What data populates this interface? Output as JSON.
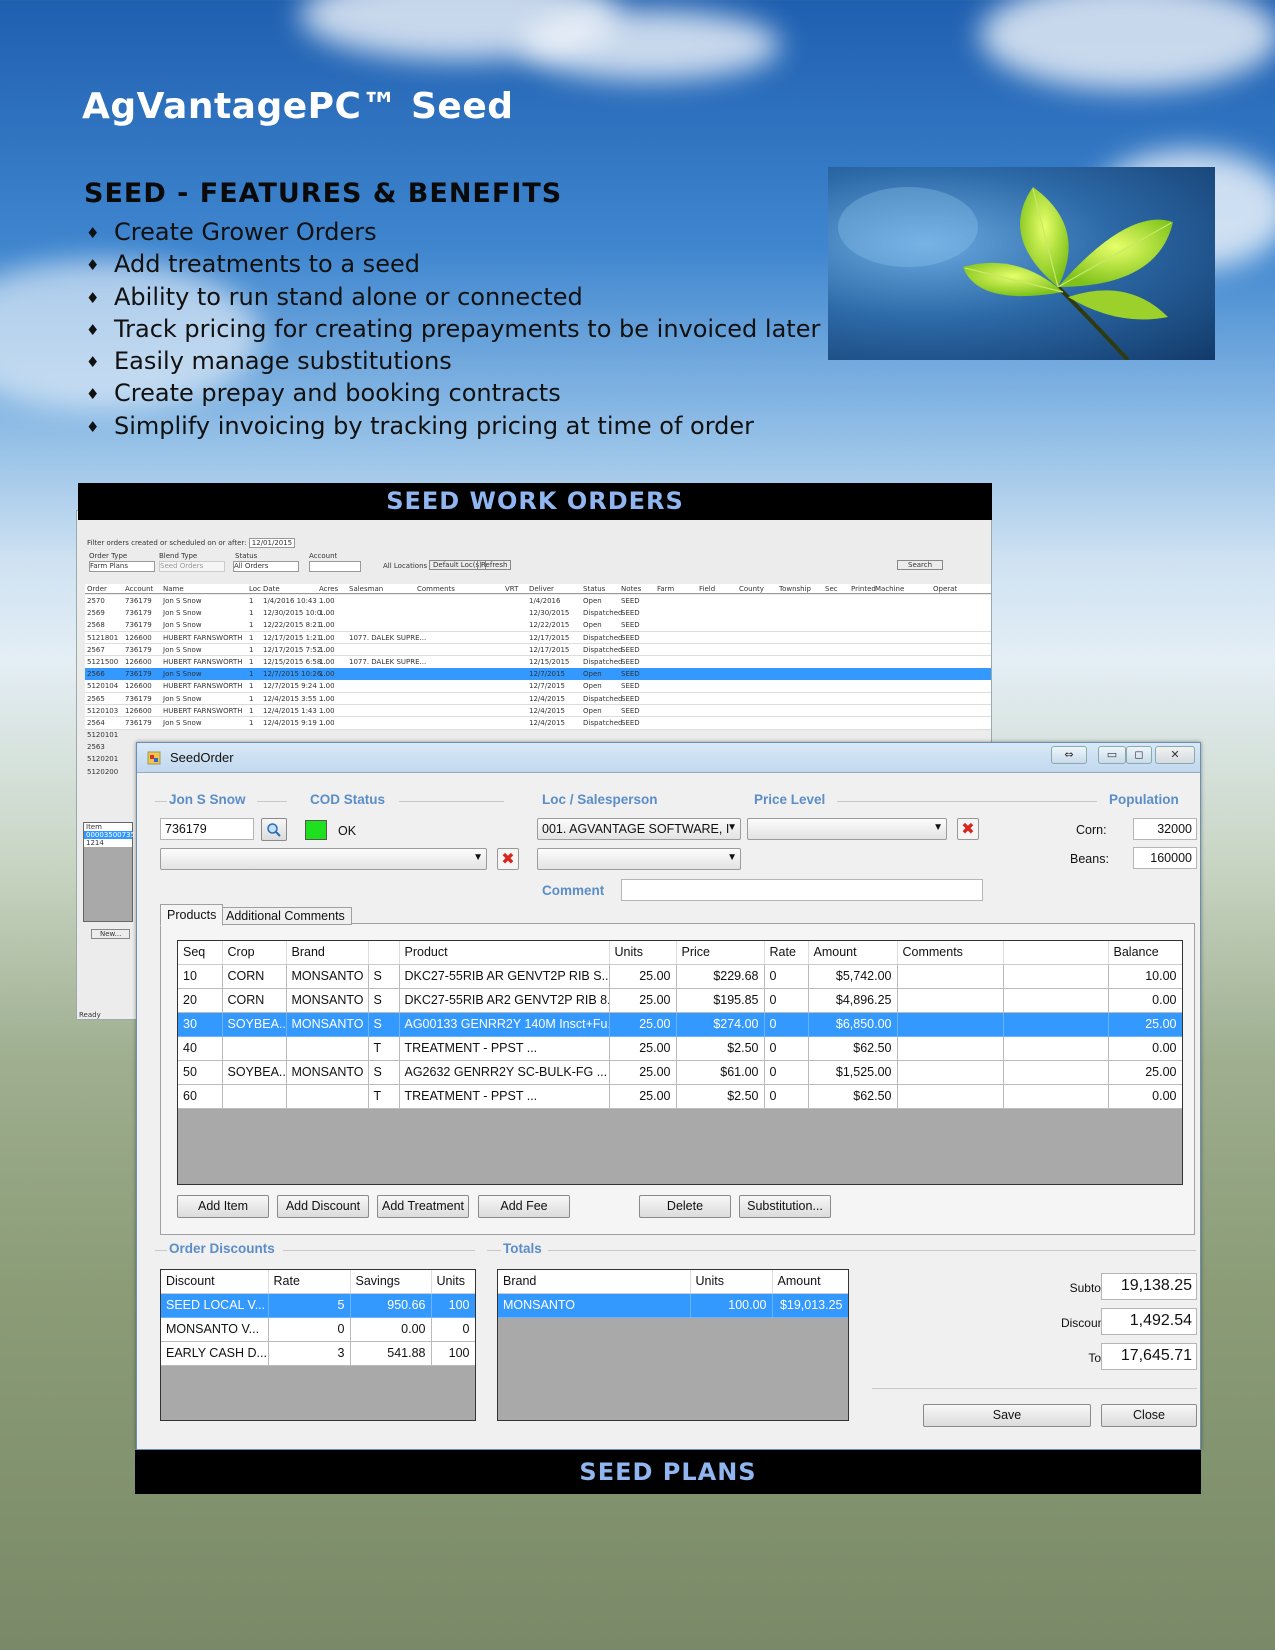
{
  "page": {
    "title": "AgVantagePC™ Seed",
    "features_heading": "SEED - FEATURES & BENEFITS",
    "features": [
      "Create Grower Orders",
      "Add treatments to a seed",
      "Ability to run stand alone or connected",
      "Track pricing for creating prepayments to be invoiced later",
      "Easily manage substitutions",
      "Create prepay and booking contracts",
      "Simplify invoicing by tracking pricing at time of order"
    ],
    "banner_top": "SEED WORK ORDERS",
    "banner_bottom": "SEED PLANS"
  },
  "background_window": {
    "filter_text": "Filter orders created or scheduled on or after:",
    "filter_date": "12/01/2015",
    "labels": {
      "order_type": "Order Type",
      "blend_type": "Blend Type",
      "status": "Status",
      "account": "Account"
    },
    "values": {
      "order_type": "Farm Plans",
      "blend_type": "Seed Orders",
      "status": "All Orders"
    },
    "all_locations": "All Locations",
    "default_locs": "Default Loc(s)",
    "refresh": "Refresh",
    "search": "Search",
    "columns": [
      "Order",
      "Account",
      "Name",
      "Loc",
      "Date",
      "Acres",
      "Salesman",
      "Comments",
      "VRT",
      "Deliver",
      "Status",
      "Notes",
      "Farm",
      "Field",
      "County",
      "Township",
      "Sec",
      "Printed",
      "Machine",
      "Operat"
    ],
    "rows": [
      [
        "2570",
        "736179",
        "Jon S Snow",
        "1",
        "1/4/2016 10:43 ...",
        "1.00",
        "",
        "",
        "",
        "1/4/2016",
        "Open",
        "SEED"
      ],
      [
        "2569",
        "736179",
        "Jon S Snow",
        "1",
        "12/30/2015 10:0...",
        "1.00",
        "",
        "",
        "",
        "12/30/2015",
        "Dispatched",
        "SEED"
      ],
      [
        "2568",
        "736179",
        "Jon S Snow",
        "1",
        "12/22/2015 8:21...",
        "1.00",
        "",
        "",
        "",
        "12/22/2015",
        "Open",
        "SEED"
      ],
      [
        "5121801",
        "126600",
        "HUBERT FARNSWORTH",
        "1",
        "12/17/2015 1:21...",
        "1.00",
        "1077. DALEK SUPRE...",
        "",
        "",
        "12/17/2015",
        "Dispatched",
        "SEED"
      ],
      [
        "2567",
        "736179",
        "Jon S Snow",
        "1",
        "12/17/2015 7:52...",
        "1.00",
        "",
        "",
        "",
        "12/17/2015",
        "Dispatched",
        "SEED"
      ],
      [
        "5121500",
        "126600",
        "HUBERT FARNSWORTH",
        "1",
        "12/15/2015 6:58...",
        "1.00",
        "1077. DALEK SUPRE...",
        "",
        "",
        "12/15/2015",
        "Dispatched",
        "SEED"
      ],
      [
        "2566",
        "736179",
        "Jon S Snow",
        "1",
        "12/7/2015 10:26...",
        "1.00",
        "",
        "",
        "",
        "12/7/2015",
        "Open",
        "SEED"
      ],
      [
        "5120104",
        "126600",
        "HUBERT FARNSWORTH",
        "1",
        "12/7/2015 9:24 ...",
        "1.00",
        "",
        "",
        "",
        "12/7/2015",
        "Open",
        "SEED"
      ],
      [
        "2565",
        "736179",
        "Jon S Snow",
        "1",
        "12/4/2015 3:55 ...",
        "1.00",
        "",
        "",
        "",
        "12/4/2015",
        "Dispatched",
        "SEED"
      ],
      [
        "5120103",
        "126600",
        "HUBERT FARNSWORTH",
        "1",
        "12/4/2015 1:43 ...",
        "1.00",
        "",
        "",
        "",
        "12/4/2015",
        "Open",
        "SEED"
      ],
      [
        "2564",
        "736179",
        "Jon S Snow",
        "1",
        "12/4/2015 9:19 ...",
        "1.00",
        "",
        "",
        "",
        "12/4/2015",
        "Dispatched",
        "SEED"
      ]
    ],
    "side_rows": [
      "5120101",
      "2563",
      "5120201",
      "5120200"
    ],
    "item_header": "Item",
    "item_rows": [
      "00003500735700",
      "1214"
    ],
    "new_button": "New...",
    "status": "Ready"
  },
  "seed_order": {
    "window_title": "SeedOrder",
    "customer_name": "Jon S Snow",
    "cod_status_label": "COD Status",
    "loc_salesperson_label": "Loc / Salesperson",
    "price_level_label": "Price Level",
    "population_label": "Population",
    "account": "736179",
    "cod_status_text": "OK",
    "location": "001. AGVANTAGE SOFTWARE, I",
    "price_level": "",
    "corn_label": "Corn:",
    "corn_value": "32000",
    "beans_label": "Beans:",
    "beans_value": "160000",
    "comment_label": "Comment",
    "comment_value": "",
    "tabs": [
      "Products",
      "Additional Comments"
    ],
    "products": {
      "columns": [
        "Seq",
        "Crop",
        "Brand",
        "",
        "Product",
        "Units",
        "Price",
        "Rate",
        "Amount",
        "Comments",
        "",
        "Balance"
      ],
      "rows": [
        {
          "seq": "10",
          "crop": "CORN",
          "brand": "MONSANTO",
          "type": "S",
          "product": "DKC27-55RIB AR GENVT2P RIB S...",
          "units": "25.00",
          "price": "$229.68",
          "rate": "0",
          "amount": "$5,742.00",
          "comments": "",
          "extra": "",
          "balance": "10.00"
        },
        {
          "seq": "20",
          "crop": "CORN",
          "brand": "MONSANTO",
          "type": "S",
          "product": "DKC27-55RIB AR2 GENVT2P RIB 8...",
          "units": "25.00",
          "price": "$195.85",
          "rate": "0",
          "amount": "$4,896.25",
          "comments": "",
          "extra": "",
          "balance": "0.00"
        },
        {
          "seq": "30",
          "crop": "SOYBEA...",
          "brand": "MONSANTO",
          "type": "S",
          "product": "AG00133 GENRR2Y 140M Insct+Fu...",
          "units": "25.00",
          "price": "$274.00",
          "rate": "0",
          "amount": "$6,850.00",
          "comments": "",
          "extra": "",
          "balance": "25.00"
        },
        {
          "seq": "40",
          "crop": "",
          "brand": "",
          "type": "T",
          "product": "TREATMENT - PPST                ...",
          "units": "25.00",
          "price": "$2.50",
          "rate": "0",
          "amount": "$62.50",
          "comments": "",
          "extra": "",
          "balance": "0.00"
        },
        {
          "seq": "50",
          "crop": "SOYBEA...",
          "brand": "MONSANTO",
          "type": "S",
          "product": "AG2632 GENRR2Y SC-BULK-FG      ...",
          "units": "25.00",
          "price": "$61.00",
          "rate": "0",
          "amount": "$1,525.00",
          "comments": "",
          "extra": "",
          "balance": "25.00"
        },
        {
          "seq": "60",
          "crop": "",
          "brand": "",
          "type": "T",
          "product": "TREATMENT - PPST                ...",
          "units": "25.00",
          "price": "$2.50",
          "rate": "0",
          "amount": "$62.50",
          "comments": "",
          "extra": "",
          "balance": "0.00"
        }
      ],
      "selected_index": 2
    },
    "buttons": {
      "add_item": "Add Item",
      "add_discount": "Add Discount",
      "add_treatment": "Add Treatment",
      "add_fee": "Add Fee",
      "delete": "Delete",
      "substitution": "Substitution...",
      "save": "Save",
      "close": "Close"
    },
    "order_discounts_label": "Order Discounts",
    "discounts": {
      "columns": [
        "Discount",
        "Rate",
        "Savings",
        "Units"
      ],
      "rows": [
        [
          "SEED LOCAL V...",
          "5",
          "950.66",
          "100"
        ],
        [
          "MONSANTO V...",
          "0",
          "0.00",
          "0"
        ],
        [
          "EARLY CASH D...",
          "3",
          "541.88",
          "100"
        ]
      ]
    },
    "totals_label": "Totals",
    "totals": {
      "columns": [
        "Brand",
        "Units",
        "Amount"
      ],
      "rows": [
        [
          "MONSANTO",
          "100.00",
          "$19,013.25"
        ]
      ]
    },
    "subtotal_label": "Subtotal:",
    "subtotal": "19,138.25",
    "discounts_label": "Discounts:",
    "discounts_total": "1,492.54",
    "total_label": "Total:",
    "total": "17,645.71"
  },
  "colors": {
    "selection": "#3399ff",
    "group_label": "#5b8dc8",
    "banner_text": "#8fb6f0"
  }
}
